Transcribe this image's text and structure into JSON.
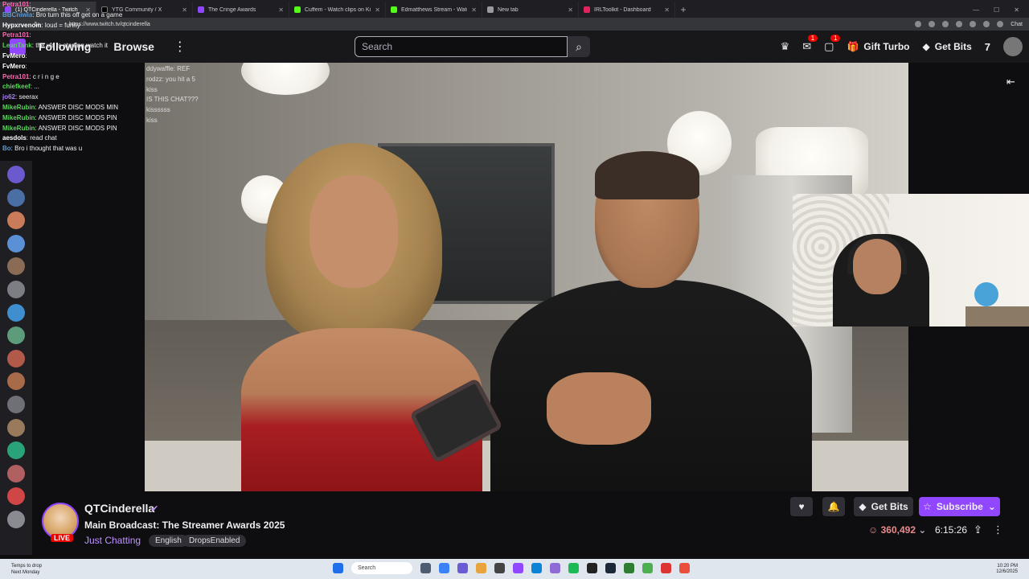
{
  "browser": {
    "tabs": [
      {
        "title": "(1) QTCinderella - Twitch",
        "active": true,
        "color": "#9147ff"
      },
      {
        "title": "YTG Community / X",
        "active": false,
        "color": "#000000"
      },
      {
        "title": "The Cringe Awards",
        "active": false,
        "color": "#9147ff"
      },
      {
        "title": "Cuffem - Watch clips on Kick",
        "active": false,
        "color": "#53fc18"
      },
      {
        "title": "Edmatthews Stream - Watch Live",
        "active": false,
        "color": "#53fc18"
      },
      {
        "title": "New tab",
        "active": false,
        "color": "#9a9aa0"
      },
      {
        "title": "IRLToolkit - Dashboard",
        "active": false,
        "color": "#e0245e"
      }
    ],
    "url": "https://www.twitch.tv/qtcinderella",
    "chat_ext_label": "Chat"
  },
  "twitch_header": {
    "following": "Following",
    "browse": "Browse",
    "search_placeholder": "Search",
    "gift_turbo": "Gift Turbo",
    "get_bits": "Get Bits",
    "inbox_badge": "1",
    "whispers_badge": "1"
  },
  "chat_overlay_left": [
    {
      "user": "Petra101",
      "text": "",
      "color": "#ff69b4"
    },
    {
      "user": "BBCniwia",
      "text": "Bro turn this off get on a game",
      "color": "#5b9bd5"
    },
    {
      "user": "Hypxrvenom",
      "text": "loud = funny",
      "color": "#ffffff"
    },
    {
      "user": "Petra101",
      "text": "",
      "color": "#ff69b4"
    },
    {
      "user": "LeanTank",
      "text": "the ufc is starting watch it",
      "color": "#5bd55b"
    },
    {
      "user": "FvMero",
      "text": "",
      "color": "#ffffff"
    },
    {
      "user": "FvMero",
      "text": "",
      "color": "#ffffff"
    },
    {
      "user": "Petra101",
      "text": "c r i n g e",
      "color": "#ff69b4"
    },
    {
      "user": "chiefkeef",
      "text": "...",
      "color": "#5bd55b"
    },
    {
      "user": "jo62",
      "text": "seerax",
      "color": "#a97bff"
    },
    {
      "user": "MikeRubin",
      "text": "ANSWER DISC MODS MIN",
      "color": "#5bd55b"
    },
    {
      "user": "MikeRubin",
      "text": "ANSWER DISC MODS PIN",
      "color": "#5bd55b"
    },
    {
      "user": "MikeRubin",
      "text": "ANSWER DISC MODS PIN",
      "color": "#5bd55b"
    },
    {
      "user": "aesdols",
      "text": "read chat",
      "color": "#ffffff"
    },
    {
      "user": "Bo",
      "text": "Bro i thought that was u",
      "color": "#5b9bd5"
    }
  ],
  "video_chat_overlay": [
    "ddywaffle: REF",
    "rodzz: you hit a 5",
    "kiss",
    "IS THIS CHAT???",
    "kissssss",
    "kiss"
  ],
  "channel": {
    "name": "QTCinderella",
    "live_label": "LIVE",
    "title": "Main Broadcast: The Streamer Awards 2025",
    "category": "Just Chatting",
    "tags": [
      "English",
      "DropsEnabled"
    ],
    "get_bits": "Get Bits",
    "subscribe": "Subscribe",
    "viewers": "360,492",
    "uptime": "6:15:26"
  },
  "taskbar": {
    "weather_line1": "Temps to drop",
    "weather_line2": "Next Monday",
    "search": "Search",
    "time": "10:20 PM",
    "date": "12/6/2025"
  },
  "colors": {
    "twitch_purple": "#9147ff",
    "live_red": "#eb0400"
  }
}
